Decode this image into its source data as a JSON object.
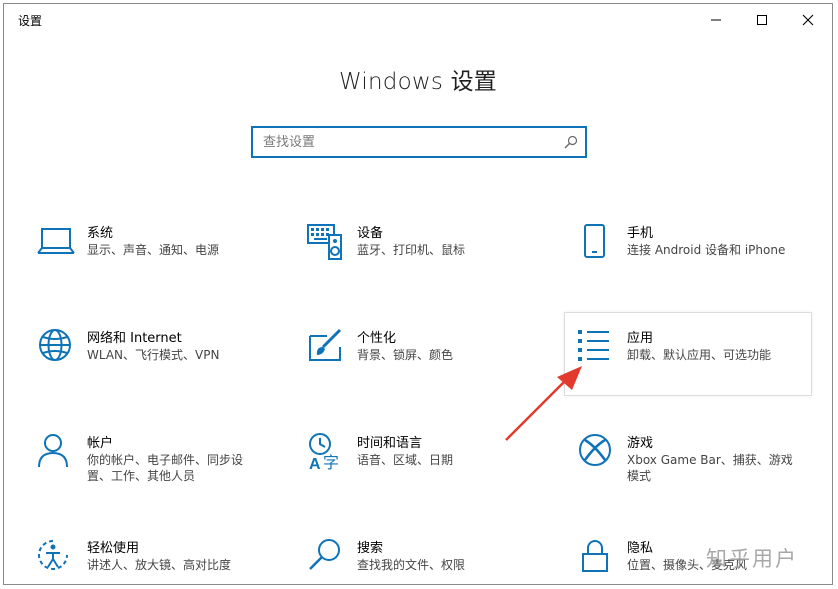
{
  "window": {
    "title": "设置",
    "minimize_icon": "minimize-icon",
    "maximize_icon": "maximize-icon",
    "close_icon": "close-icon"
  },
  "header": {
    "title": "Windows 设置"
  },
  "search": {
    "placeholder": "查找设置",
    "value": "",
    "icon": "search-icon"
  },
  "categories": [
    {
      "name": "系统",
      "desc": "显示、声音、通知、电源",
      "icon": "laptop-icon"
    },
    {
      "name": "设备",
      "desc": "蓝牙、打印机、鼠标",
      "icon": "keyboard-speaker-icon"
    },
    {
      "name": "手机",
      "desc": "连接 Android 设备和 iPhone",
      "icon": "phone-icon"
    },
    {
      "name": "网络和 Internet",
      "desc": "WLAN、飞行模式、VPN",
      "icon": "globe-icon"
    },
    {
      "name": "个性化",
      "desc": "背景、锁屏、颜色",
      "icon": "paintbrush-icon"
    },
    {
      "name": "应用",
      "desc": "卸载、默认应用、可选功能",
      "icon": "apps-list-icon"
    },
    {
      "name": "帐户",
      "desc": "你的帐户、电子邮件、同步设置、工作、其他人员",
      "icon": "person-icon"
    },
    {
      "name": "时间和语言",
      "desc": "语音、区域、日期",
      "icon": "time-language-icon"
    },
    {
      "name": "游戏",
      "desc": "Xbox Game Bar、捕获、游戏模式",
      "icon": "xbox-icon"
    },
    {
      "name": "轻松使用",
      "desc": "讲述人、放大镜、高对比度",
      "icon": "ease-of-access-icon"
    },
    {
      "name": "搜索",
      "desc": "查找我的文件、权限",
      "icon": "magnifier-icon"
    },
    {
      "name": "隐私",
      "desc": "位置、摄像头、麦克风",
      "icon": "lock-icon"
    }
  ],
  "watermark": "知乎用户",
  "colors": {
    "accent": "#0f73b8",
    "annotation_arrow": "#e23b2e"
  }
}
